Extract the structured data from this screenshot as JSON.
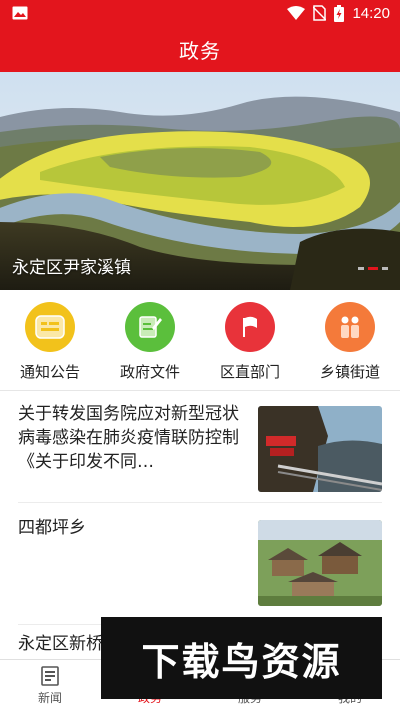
{
  "status_bar": {
    "time": "14:20"
  },
  "header": {
    "title": "政务"
  },
  "banner": {
    "caption": "永定区尹家溪镇",
    "slide_count": 3,
    "active_slide": 2
  },
  "categories": [
    {
      "label": "通知公告",
      "icon": "notice-icon",
      "color": "#f2c21b"
    },
    {
      "label": "政府文件",
      "icon": "document-icon",
      "color": "#5bbf3c"
    },
    {
      "label": "区直部门",
      "icon": "flag-icon",
      "color": "#e8333a"
    },
    {
      "label": "乡镇街道",
      "icon": "people-icon",
      "color": "#f47a3a"
    }
  ],
  "news": [
    {
      "title": "关于转发国务院应对新型冠状病毒感染在肺炎疫情联防控制《关于印发不同…"
    },
    {
      "title": "四都坪乡"
    },
    {
      "title": "永定区新桥"
    }
  ],
  "bottom_nav": {
    "tabs": [
      {
        "label": "新闻",
        "active": false
      },
      {
        "label": "政务",
        "active": true
      },
      {
        "label": "服务",
        "active": false
      },
      {
        "label": "我的",
        "active": false
      }
    ]
  },
  "watermark": {
    "text": "下载鸟资源"
  },
  "colors": {
    "brand_red": "#e3151d"
  }
}
